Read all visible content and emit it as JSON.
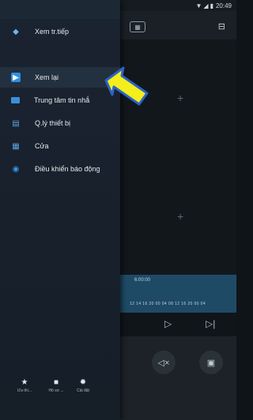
{
  "status_bar": {
    "time": "20:49",
    "wifi": "▼",
    "signal": "◢",
    "battery": "▮"
  },
  "background": {
    "grid_icon": "grid-icon",
    "top_right_icon": "device-list-icon",
    "pane_plus": "+",
    "timeline_time": "6:00:00",
    "timeline_ticks": "12 14 16 20 00 04 08 12 16 20 00 04",
    "play_icon": "▷",
    "next_icon": "▷|",
    "mute_icon": "◁×",
    "record_icon": "▣"
  },
  "drawer": {
    "items": [
      {
        "label": "Xem tr.tiếp",
        "icon": "live-view-icon"
      },
      {
        "label": "Xem lại",
        "icon": "playback-icon"
      },
      {
        "label": "Trung tâm tin nhắ",
        "icon": "message-center-icon"
      },
      {
        "label": "Q.lý thiết bị",
        "icon": "device-manager-icon"
      },
      {
        "label": "Cửa",
        "icon": "door-icon"
      },
      {
        "label": "Điều khiển báo động",
        "icon": "alarm-control-icon"
      }
    ],
    "bottom_tabs": [
      {
        "label": "Ưa thí...",
        "icon": "star-icon"
      },
      {
        "label": "Hồ sơ ...",
        "icon": "folder-icon"
      },
      {
        "label": "Cài đặt",
        "icon": "settings-icon"
      }
    ]
  },
  "colors": {
    "accent": "#2f8fe3",
    "arrow_fill": "#f4ee1c",
    "arrow_stroke": "#2b63c7"
  }
}
